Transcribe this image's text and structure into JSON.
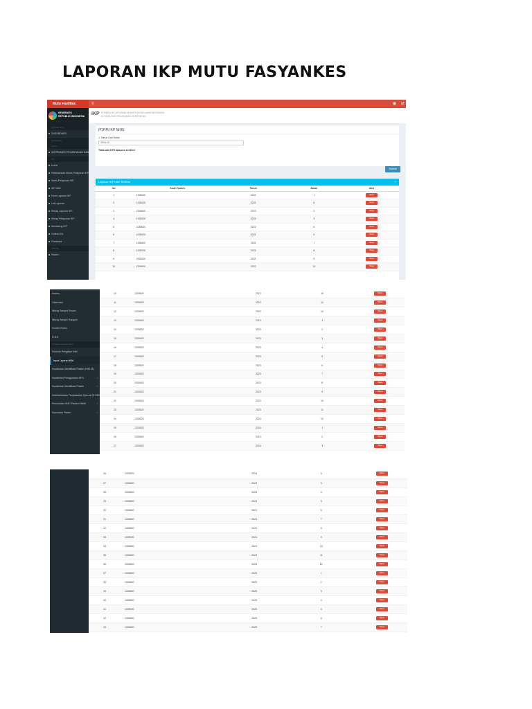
{
  "doc_title": "LAPORAN IKP MUTU FASYANKES",
  "app": {
    "brand": "Mutu Fasilitas",
    "hamburger": "≡",
    "user_icon": "◉",
    "share_icon": "⇄",
    "logo_line1": "KEMENKES",
    "logo_line2": "REPUBLIK INDONESIA",
    "page_tag": "IKP",
    "crumb_line1": "FORMULIR LAPORAN INSIDEN KESELAMATAN PASIEN",
    "crumb_line2": "DI FASILITAS PELAYANAN KESEHATAN"
  },
  "sidebar1": [
    {
      "label": "NAVIGATION",
      "head": true
    },
    {
      "label": "DASHBOARD"
    },
    {
      "label": "Dashboard",
      "head": true
    },
    {
      "label": "Survei",
      "head": true
    },
    {
      "label": "INSTRUMEN PEMANTAUAN DAN EVALUASI"
    },
    {
      "label": "IKP",
      "head": true
    },
    {
      "label": "Home"
    },
    {
      "label": "Pelaksanaan Akses Pelaporan IKP"
    },
    {
      "label": "Alerts Pelaporan IKP"
    },
    {
      "label": "IKP Nihil"
    },
    {
      "label": "Form Laporan IKP"
    },
    {
      "label": "List Laporan"
    },
    {
      "label": "Rekap Laporan IKP"
    },
    {
      "label": "Rekap Pelaporan IKP"
    },
    {
      "label": "Monitoring IKP"
    },
    {
      "label": "Contact Us"
    },
    {
      "label": "Feedback"
    },
    {
      "label": "SURVEI",
      "head": true
    },
    {
      "label": "Pasien"
    }
  ],
  "form": {
    "title": "FORM IKP NIHIL",
    "label": "1. Tahun Dan Bulan",
    "value": "2024-10",
    "note": "Tidak ada KTD ataupun sentinel",
    "submit": "Submit"
  },
  "report": {
    "title": "Laporan IKP Nihil Terkirim",
    "toggle": "+"
  },
  "columns": [
    "No",
    "Kode Faskes",
    "Tahun",
    "Bulan",
    "Aksi"
  ],
  "action_label": "Hapus",
  "rows1": [
    {
      "no": "1",
      "kode": "1330620",
      "tahun": "2022",
      "bulan": "1"
    },
    {
      "no": "2",
      "kode": "1330620",
      "tahun": "2022",
      "bulan": "8"
    },
    {
      "no": "3",
      "kode": "1330620",
      "tahun": "2022",
      "bulan": "2"
    },
    {
      "no": "4",
      "kode": "1330620",
      "tahun": "2022",
      "bulan": "3"
    },
    {
      "no": "5",
      "kode": "1330620",
      "tahun": "2022",
      "bulan": "5"
    },
    {
      "no": "6",
      "kode": "1330620",
      "tahun": "2022",
      "bulan": "6"
    },
    {
      "no": "7",
      "kode": "1330620",
      "tahun": "2022",
      "bulan": "7"
    },
    {
      "no": "8",
      "kode": "1330620",
      "tahun": "2022",
      "bulan": "8"
    },
    {
      "no": "9",
      "kode": "1330620",
      "tahun": "2022",
      "bulan": "9"
    },
    {
      "no": "10",
      "kode": "1330620",
      "tahun": "2022",
      "bulan": "10"
    }
  ],
  "sidebar2": [
    {
      "label": "Pasien"
    },
    {
      "label": "Observasi"
    },
    {
      "label": "Hitung Sampel Pasien"
    },
    {
      "label": "Hitung Sampel Rangsel"
    },
    {
      "label": "Kondisi Kamu"
    },
    {
      "label": "O.B.S"
    },
    {
      "label": "Indikator Nasional Mutu",
      "head": true
    },
    {
      "label": "Formulir Pengisian INM"
    },
    {
      "label": "Input Laporan INM",
      "active": true
    },
    {
      "label": "Kepatuhan Identifikasi Pasien (INM-01)"
    },
    {
      "label": "Kepatuhan Penggunaan APD",
      "caret": true
    },
    {
      "label": "Kepatuhan Identifikasi Pasien",
      "caret": true
    },
    {
      "label": "Keterlambatan Penjadwalan Operasi Di IGD",
      "caret": true
    },
    {
      "label": "Penundaan HMC Pasien Elektif",
      "caret": true
    },
    {
      "label": "Kepuasan Pasien",
      "caret": true
    }
  ],
  "rows2": [
    {
      "no": "10",
      "kode": "1330620",
      "tahun": "2022",
      "bulan": "10"
    },
    {
      "no": "11",
      "kode": "1330620",
      "tahun": "2022",
      "bulan": "11"
    },
    {
      "no": "12",
      "kode": "1330620",
      "tahun": "2022",
      "bulan": "12"
    },
    {
      "no": "13",
      "kode": "1330620",
      "tahun": "2023",
      "bulan": "1"
    },
    {
      "no": "14",
      "kode": "1330620",
      "tahun": "2023",
      "bulan": "2"
    },
    {
      "no": "15",
      "kode": "1330620",
      "tahun": "2023",
      "bulan": "3"
    },
    {
      "no": "16",
      "kode": "1330620",
      "tahun": "2023",
      "bulan": "4"
    },
    {
      "no": "17",
      "kode": "1330620",
      "tahun": "2023",
      "bulan": "5"
    },
    {
      "no": "18",
      "kode": "1330620",
      "tahun": "2023",
      "bulan": "6"
    },
    {
      "no": "19",
      "kode": "1330620",
      "tahun": "2023",
      "bulan": "7"
    },
    {
      "no": "20",
      "kode": "1330620",
      "tahun": "2023",
      "bulan": "8"
    },
    {
      "no": "21",
      "kode": "1330620",
      "tahun": "2023",
      "bulan": "9"
    },
    {
      "no": "22",
      "kode": "1330620",
      "tahun": "2023",
      "bulan": "10"
    },
    {
      "no": "23",
      "kode": "1330620",
      "tahun": "2023",
      "bulan": "11"
    },
    {
      "no": "24",
      "kode": "1330620",
      "tahun": "2023",
      "bulan": "12"
    },
    {
      "no": "25",
      "kode": "1330620",
      "tahun": "2024",
      "bulan": "1"
    },
    {
      "no": "26",
      "kode": "1330620",
      "tahun": "2024",
      "bulan": "2"
    },
    {
      "no": "27",
      "kode": "1330620",
      "tahun": "2024",
      "bulan": "3"
    }
  ],
  "rows3": [
    {
      "no": "26",
      "kode": "1330620",
      "tahun": "2024",
      "bulan": "3"
    },
    {
      "no": "27",
      "kode": "1330620",
      "tahun": "2024",
      "bulan": "3"
    },
    {
      "no": "28",
      "kode": "1330620",
      "tahun": "2024",
      "bulan": "4"
    },
    {
      "no": "29",
      "kode": "1330620",
      "tahun": "2024",
      "bulan": "5"
    },
    {
      "no": "30",
      "kode": "1330620",
      "tahun": "2024",
      "bulan": "6"
    },
    {
      "no": "31",
      "kode": "1330620",
      "tahun": "2024",
      "bulan": "7"
    },
    {
      "no": "32",
      "kode": "1330620",
      "tahun": "2024",
      "bulan": "8"
    },
    {
      "no": "33",
      "kode": "1330620",
      "tahun": "2024",
      "bulan": "9"
    },
    {
      "no": "34",
      "kode": "1330620",
      "tahun": "2024",
      "bulan": "10"
    },
    {
      "no": "35",
      "kode": "1330620",
      "tahun": "2024",
      "bulan": "11"
    },
    {
      "no": "36",
      "kode": "1330620",
      "tahun": "2024",
      "bulan": "12"
    },
    {
      "no": "37",
      "kode": "1330620",
      "tahun": "2025",
      "bulan": "1"
    },
    {
      "no": "38",
      "kode": "1330620",
      "tahun": "2025",
      "bulan": "2"
    },
    {
      "no": "39",
      "kode": "1330620",
      "tahun": "2025",
      "bulan": "3"
    },
    {
      "no": "40",
      "kode": "1330620",
      "tahun": "2025",
      "bulan": "4"
    },
    {
      "no": "41",
      "kode": "1330620",
      "tahun": "2025",
      "bulan": "5"
    },
    {
      "no": "42",
      "kode": "1330620",
      "tahun": "2025",
      "bulan": "6"
    },
    {
      "no": "43",
      "kode": "1330620",
      "tahun": "2025",
      "bulan": "7"
    }
  ]
}
